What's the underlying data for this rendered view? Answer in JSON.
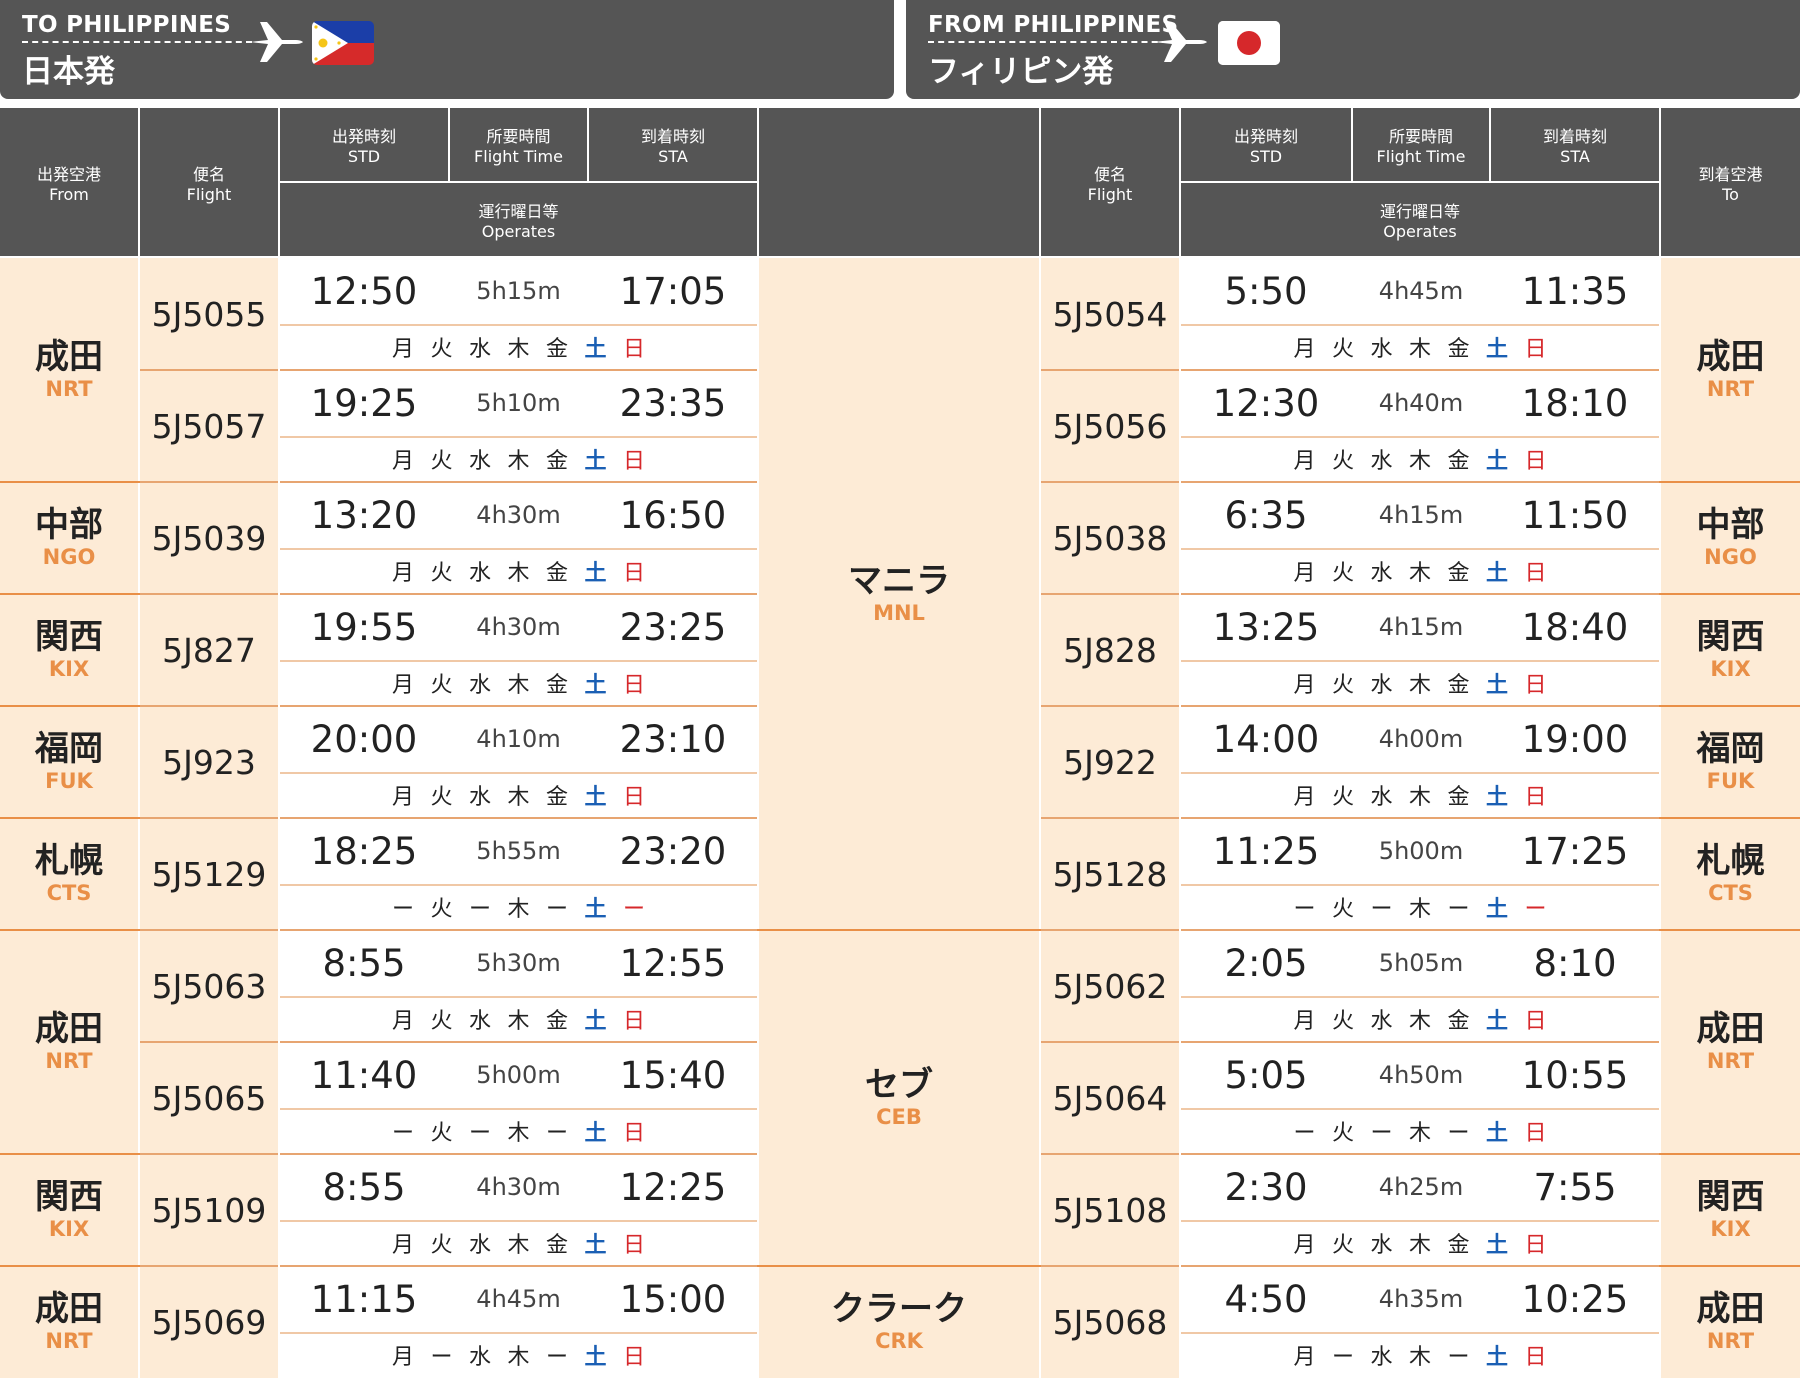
{
  "banner_left": {
    "en": "TO PHILIPPINES",
    "ja": "日本発"
  },
  "banner_right": {
    "en": "FROM PHILIPPINES",
    "ja": "フィリピン発"
  },
  "header": {
    "from_ja": "出発空港",
    "from_en": "From",
    "flight_ja": "便名",
    "flight_en": "Flight",
    "std_ja": "出発時刻",
    "std_en": "STD",
    "ft_ja": "所要時間",
    "ft_en": "Flight Time",
    "sta_ja": "到着時刻",
    "sta_en": "STA",
    "op_ja": "運行曜日等",
    "op_en": "Operates",
    "to_ja": "到着空港",
    "to_en": "To"
  },
  "destinations": [
    {
      "ja": "マニラ",
      "code": "MNL"
    },
    {
      "ja": "セブ",
      "code": "CEB"
    },
    {
      "ja": "クラーク",
      "code": "CRK"
    }
  ],
  "airports": [
    {
      "ja": "成田",
      "code": "NRT"
    },
    {
      "ja": "中部",
      "code": "NGO"
    },
    {
      "ja": "関西",
      "code": "KIX"
    },
    {
      "ja": "福岡",
      "code": "FUK"
    },
    {
      "ja": "札幌",
      "code": "CTS"
    },
    {
      "ja": "成田",
      "code": "NRT"
    },
    {
      "ja": "関西",
      "code": "KIX"
    },
    {
      "ja": "成田",
      "code": "NRT"
    }
  ],
  "rows": [
    {
      "out_flight": "5J5055",
      "out_std": "12:50",
      "out_ft": "5h15m",
      "out_sta": "17:05",
      "out_days": [
        "月",
        "火",
        "水",
        "木",
        "金",
        "土",
        "日"
      ],
      "ret_flight": "5J5054",
      "ret_std": "5:50",
      "ret_ft": "4h45m",
      "ret_sta": "11:35",
      "ret_days": [
        "月",
        "火",
        "水",
        "木",
        "金",
        "土",
        "日"
      ]
    },
    {
      "out_flight": "5J5057",
      "out_std": "19:25",
      "out_ft": "5h10m",
      "out_sta": "23:35",
      "out_days": [
        "月",
        "火",
        "水",
        "木",
        "金",
        "土",
        "日"
      ],
      "ret_flight": "5J5056",
      "ret_std": "12:30",
      "ret_ft": "4h40m",
      "ret_sta": "18:10",
      "ret_days": [
        "月",
        "火",
        "水",
        "木",
        "金",
        "土",
        "日"
      ]
    },
    {
      "out_flight": "5J5039",
      "out_std": "13:20",
      "out_ft": "4h30m",
      "out_sta": "16:50",
      "out_days": [
        "月",
        "火",
        "水",
        "木",
        "金",
        "土",
        "日"
      ],
      "ret_flight": "5J5038",
      "ret_std": "6:35",
      "ret_ft": "4h15m",
      "ret_sta": "11:50",
      "ret_days": [
        "月",
        "火",
        "水",
        "木",
        "金",
        "土",
        "日"
      ]
    },
    {
      "out_flight": "5J827",
      "out_std": "19:55",
      "out_ft": "4h30m",
      "out_sta": "23:25",
      "out_days": [
        "月",
        "火",
        "水",
        "木",
        "金",
        "土",
        "日"
      ],
      "ret_flight": "5J828",
      "ret_std": "13:25",
      "ret_ft": "4h15m",
      "ret_sta": "18:40",
      "ret_days": [
        "月",
        "火",
        "水",
        "木",
        "金",
        "土",
        "日"
      ]
    },
    {
      "out_flight": "5J923",
      "out_std": "20:00",
      "out_ft": "4h10m",
      "out_sta": "23:10",
      "out_days": [
        "月",
        "火",
        "水",
        "木",
        "金",
        "土",
        "日"
      ],
      "ret_flight": "5J922",
      "ret_std": "14:00",
      "ret_ft": "4h00m",
      "ret_sta": "19:00",
      "ret_days": [
        "月",
        "火",
        "水",
        "木",
        "金",
        "土",
        "日"
      ]
    },
    {
      "out_flight": "5J5129",
      "out_std": "18:25",
      "out_ft": "5h55m",
      "out_sta": "23:20",
      "out_days": [
        "ー",
        "火",
        "ー",
        "木",
        "ー",
        "土",
        "ー"
      ],
      "ret_flight": "5J5128",
      "ret_std": "11:25",
      "ret_ft": "5h00m",
      "ret_sta": "17:25",
      "ret_days": [
        "ー",
        "火",
        "ー",
        "木",
        "ー",
        "土",
        "ー"
      ]
    },
    {
      "out_flight": "5J5063",
      "out_std": "8:55",
      "out_ft": "5h30m",
      "out_sta": "12:55",
      "out_days": [
        "月",
        "火",
        "水",
        "木",
        "金",
        "土",
        "日"
      ],
      "ret_flight": "5J5062",
      "ret_std": "2:05",
      "ret_ft": "5h05m",
      "ret_sta": "8:10",
      "ret_days": [
        "月",
        "火",
        "水",
        "木",
        "金",
        "土",
        "日"
      ]
    },
    {
      "out_flight": "5J5065",
      "out_std": "11:40",
      "out_ft": "5h00m",
      "out_sta": "15:40",
      "out_days": [
        "ー",
        "火",
        "ー",
        "木",
        "ー",
        "土",
        "日"
      ],
      "ret_flight": "5J5064",
      "ret_std": "5:05",
      "ret_ft": "4h50m",
      "ret_sta": "10:55",
      "ret_days": [
        "ー",
        "火",
        "ー",
        "木",
        "ー",
        "土",
        "日"
      ]
    },
    {
      "out_flight": "5J5109",
      "out_std": "8:55",
      "out_ft": "4h30m",
      "out_sta": "12:25",
      "out_days": [
        "月",
        "火",
        "水",
        "木",
        "金",
        "土",
        "日"
      ],
      "ret_flight": "5J5108",
      "ret_std": "2:30",
      "ret_ft": "4h25m",
      "ret_sta": "7:55",
      "ret_days": [
        "月",
        "火",
        "水",
        "木",
        "金",
        "土",
        "日"
      ]
    },
    {
      "out_flight": "5J5069",
      "out_std": "11:15",
      "out_ft": "4h45m",
      "out_sta": "15:00",
      "out_days": [
        "月",
        "ー",
        "水",
        "木",
        "ー",
        "土",
        "日"
      ],
      "ret_flight": "5J5068",
      "ret_std": "4:50",
      "ret_ft": "4h35m",
      "ret_sta": "10:25",
      "ret_days": [
        "月",
        "ー",
        "水",
        "木",
        "ー",
        "土",
        "日"
      ]
    }
  ],
  "colors": {
    "header_bg": "#555555",
    "peach": "#fdebd6",
    "accent_orange": "#e98f47",
    "saturday": "#1a5fb4",
    "sunday": "#d6282b"
  },
  "icons": {
    "plane": "airplane-icon",
    "flag_left": "philippines-flag-icon",
    "flag_right": "japan-flag-icon"
  }
}
